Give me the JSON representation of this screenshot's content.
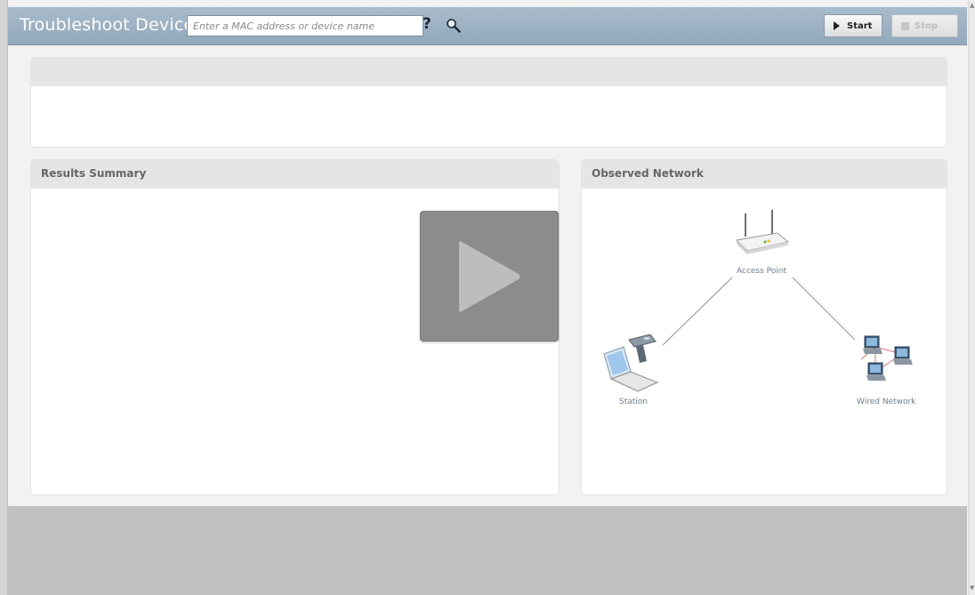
{
  "toolbar": {
    "title": "Troubleshoot Device:",
    "search_placeholder": "Enter a MAC address or device name",
    "help_glyph": "?",
    "start_label": "Start",
    "stop_label": "Stop"
  },
  "panels": {
    "results_title": "Results Summary",
    "network_title": "Observed Network"
  },
  "network": {
    "access_point_label": "Access Point",
    "station_label": "Station",
    "wired_label": "Wired Network"
  },
  "icons": {
    "help": "help-icon",
    "search": "search-icon",
    "play": "play-icon",
    "start": "play-icon",
    "stop": "stop-icon",
    "access_point": "access-point-icon",
    "station": "laptop-icon",
    "wired": "wired-network-icon"
  },
  "colors": {
    "toolbar": "#9fb3c5",
    "panel_header": "#e5e5e5",
    "overlay": "#8c8c8c"
  }
}
